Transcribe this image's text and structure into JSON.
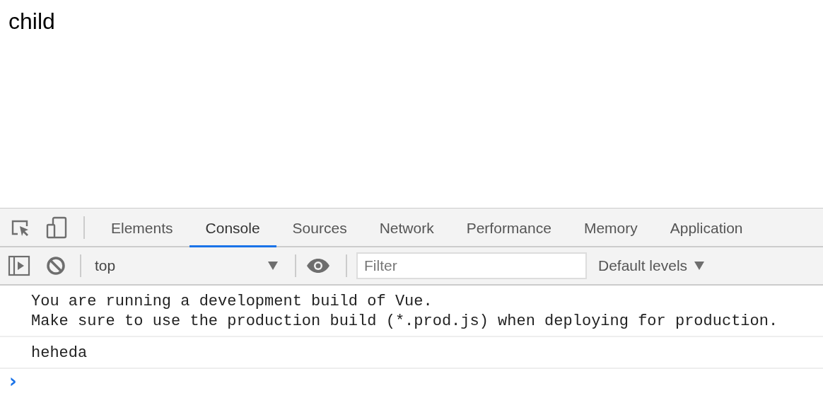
{
  "page": {
    "heading": "child"
  },
  "devtools": {
    "tabs": [
      {
        "label": "Elements",
        "selected": false
      },
      {
        "label": "Console",
        "selected": true
      },
      {
        "label": "Sources",
        "selected": false
      },
      {
        "label": "Network",
        "selected": false
      },
      {
        "label": "Performance",
        "selected": false
      },
      {
        "label": "Memory",
        "selected": false
      },
      {
        "label": "Application",
        "selected": false
      }
    ],
    "context": {
      "value": "top"
    },
    "filter": {
      "placeholder": "Filter"
    },
    "levels": {
      "label": "Default levels"
    },
    "messages": [
      {
        "lines": [
          "You are running a development build of Vue.",
          "Make sure to use the production build (*.prod.js) when deploying for production."
        ]
      },
      {
        "lines": [
          "heheda"
        ]
      }
    ],
    "prompt": {
      "symbol": "›"
    }
  }
}
